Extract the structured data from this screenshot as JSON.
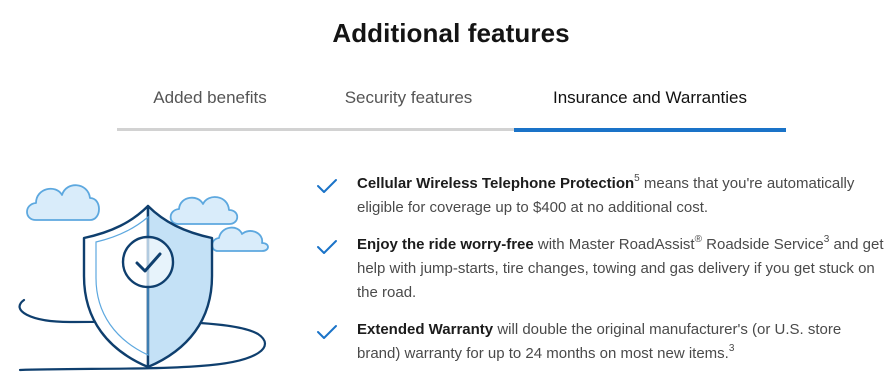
{
  "page": {
    "title": "Additional features"
  },
  "tabs": [
    {
      "label": "Added benefits",
      "active": false
    },
    {
      "label": "Security features",
      "active": false
    },
    {
      "label": "Insurance and Warranties",
      "active": true
    }
  ],
  "colors": {
    "accent": "#1a73c8",
    "check": "#1a73c8",
    "shield_fill": "#c4e1f6",
    "outline": "#0f3f6e"
  },
  "icons": {
    "check": "check-icon",
    "illustration": "shield-check-illustration"
  },
  "features": [
    {
      "bold": "Cellular Wireless Telephone Protection",
      "sup1": "5",
      "text1": " means that you're automatically eligible for coverage up to $400 at no additional cost.",
      "sup2": "",
      "text2": ""
    },
    {
      "bold": "Enjoy the ride worry-free",
      "sup1": "",
      "text1": " with Master RoadAssist",
      "sup2": "®",
      "text2": " Roadside Service",
      "sup3": "3",
      "text3": " and get help with jump-starts, tire changes, towing and gas delivery if you get stuck on the road."
    },
    {
      "bold": "Extended Warranty",
      "sup1": "",
      "text1": " will double the original manufacturer's (or U.S. store brand) warranty for up to 24 months on most new items.",
      "sup2": "3",
      "text2": ""
    }
  ]
}
